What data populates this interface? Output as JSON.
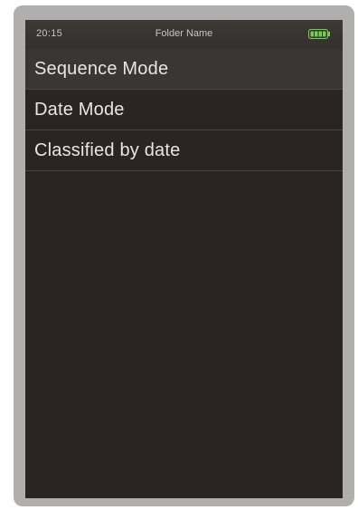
{
  "status_bar": {
    "time": "20:15",
    "title": "Folder Name",
    "battery_icon": "battery-full-icon",
    "battery_color": "#6fd24c"
  },
  "menu": {
    "items": [
      {
        "label": "Sequence Mode",
        "selected": true
      },
      {
        "label": "Date Mode",
        "selected": false
      },
      {
        "label": "Classified by date",
        "selected": false
      }
    ]
  }
}
